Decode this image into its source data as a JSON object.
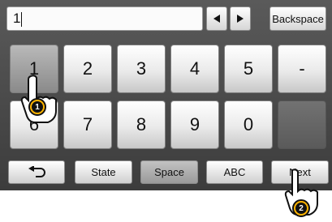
{
  "input": {
    "value": "1"
  },
  "nav": {
    "left_icon": "left-arrow-icon",
    "right_icon": "right-arrow-icon",
    "backspace_label": "Backspace"
  },
  "keys": {
    "row1": [
      "1",
      "2",
      "3",
      "4",
      "5",
      "-"
    ],
    "row2": [
      "6",
      "7",
      "8",
      "9",
      "0"
    ]
  },
  "bottom": {
    "back_icon": "return-icon",
    "state_label": "State",
    "space_label": "Space",
    "abc_label": "ABC",
    "next_label": "Next"
  },
  "callouts": [
    "1",
    "2"
  ],
  "colors": {
    "frame": "#4a4a4a",
    "callout": "#ffb400"
  }
}
